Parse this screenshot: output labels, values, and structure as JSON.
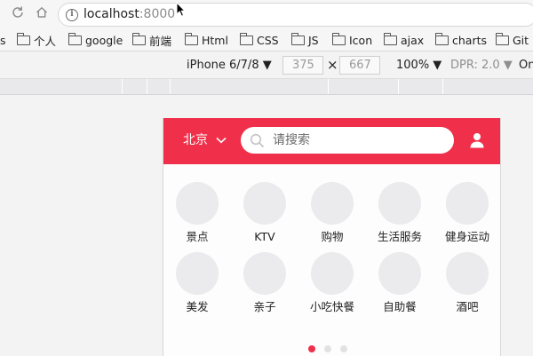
{
  "browser": {
    "url_host": "localhost",
    "url_port": ":8000"
  },
  "bookmarks": [
    {
      "label": "s",
      "folder": false
    },
    {
      "label": "个人",
      "folder": true
    },
    {
      "label": "google",
      "folder": true
    },
    {
      "label": "前端",
      "folder": true
    },
    {
      "label": "Html",
      "folder": true
    },
    {
      "label": "CSS",
      "folder": true
    },
    {
      "label": "JS",
      "folder": true
    },
    {
      "label": "Icon",
      "folder": true
    },
    {
      "label": "ajax",
      "folder": true
    },
    {
      "label": "charts",
      "folder": true
    },
    {
      "label": "Git",
      "folder": true
    }
  ],
  "device_toolbar": {
    "device": "iPhone 6/7/8 ▼",
    "width": "375",
    "times": "×",
    "height": "667",
    "zoom": "100% ▼",
    "dpr": "DPR: 2.0 ▼",
    "online": "On"
  },
  "mobile": {
    "city": "北京",
    "search_placeholder": "请搜索",
    "accent_color": "#f0304a",
    "categories": [
      {
        "label": "景点"
      },
      {
        "label": "KTV"
      },
      {
        "label": "购物"
      },
      {
        "label": "生活服务"
      },
      {
        "label": "健身运动"
      },
      {
        "label": "美发"
      },
      {
        "label": "亲子"
      },
      {
        "label": "小吃快餐"
      },
      {
        "label": "自助餐"
      },
      {
        "label": "酒吧"
      }
    ],
    "pager": {
      "count": 3,
      "active": 1
    }
  },
  "icons": {
    "reload": "reload-icon",
    "home": "home-icon",
    "info": "info-icon",
    "folder": "folder-icon",
    "search": "search-icon",
    "user": "user-icon",
    "chevron": "chevron-down-icon"
  }
}
